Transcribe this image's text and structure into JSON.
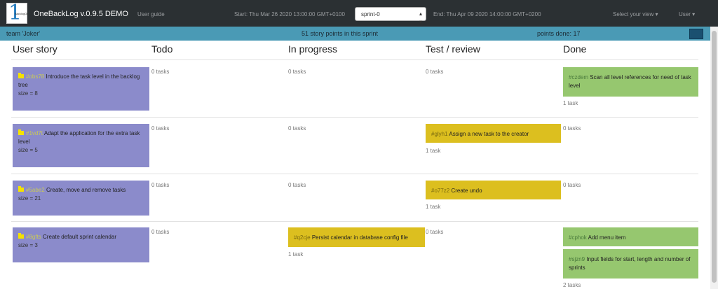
{
  "navbar": {
    "logo_glyph": "1",
    "logo_word": "BacklogOn",
    "brand": "OneBackLog v.0.9.5 DEMO",
    "user_guide": "User guide",
    "start": "Start: Thu Mar 26 2020 13:00:00 GMT+0100",
    "sprint_selected": "sprint-0",
    "end": "End: Thu Apr 09 2020 14:00:00 GMT+0200",
    "select_view": "Select your view ▾",
    "user": "User ▾"
  },
  "teambar": {
    "team": "team 'Joker'",
    "story_points": "51 story points in this sprint",
    "points_done": "points done: 17"
  },
  "columns": [
    "User story",
    "Todo",
    "In progress",
    "Test / review",
    "Done"
  ],
  "rows": [
    {
      "story": {
        "id": "#obs78",
        "title": "Introduce the task level in the backlog tree",
        "size": "size = 8"
      },
      "todo": "0 tasks",
      "in_progress": "0 tasks",
      "test": "0 tasks",
      "done_tasks": [
        {
          "id": "#czdem",
          "title": "Scan all level references for need of task level"
        }
      ],
      "done": "1 task"
    },
    {
      "story": {
        "id": "#1vd7t",
        "title": "Adapt the application for the extra task level",
        "size": "size = 5"
      },
      "todo": "0 tasks",
      "in_progress": "0 tasks",
      "test_tasks": [
        {
          "id": "#glyh1",
          "title": "Assign a new task to the creator"
        }
      ],
      "test": "1 task",
      "done": "0 tasks"
    },
    {
      "story": {
        "id": "#5abe2",
        "title": "Create, move and remove tasks",
        "size": "size = 21"
      },
      "todo": "0 tasks",
      "in_progress": "0 tasks",
      "test_tasks": [
        {
          "id": "#o77z2",
          "title": "Create undo"
        }
      ],
      "test": "1 task",
      "done": "0 tasks"
    },
    {
      "story": {
        "id": "#8gfts",
        "title": "Create default sprint calendar",
        "size": "size = 3"
      },
      "todo": "0 tasks",
      "in_progress_tasks": [
        {
          "id": "#q2cje",
          "title": "Persist calendar in database config file"
        }
      ],
      "in_progress": "1 task",
      "test": "0 tasks",
      "done_tasks": [
        {
          "id": "#cphok",
          "title": "Add menu item"
        },
        {
          "id": "#sjzn9",
          "title": "Input fields for start, length and number of sprints"
        }
      ],
      "done": "2 tasks"
    }
  ],
  "colors": {
    "navbar": "#2b3033",
    "teambar": "#4a9ab5",
    "story": "#8b8bcb",
    "task_yellow": "#dcbf1f",
    "task_green": "#96c76f"
  }
}
